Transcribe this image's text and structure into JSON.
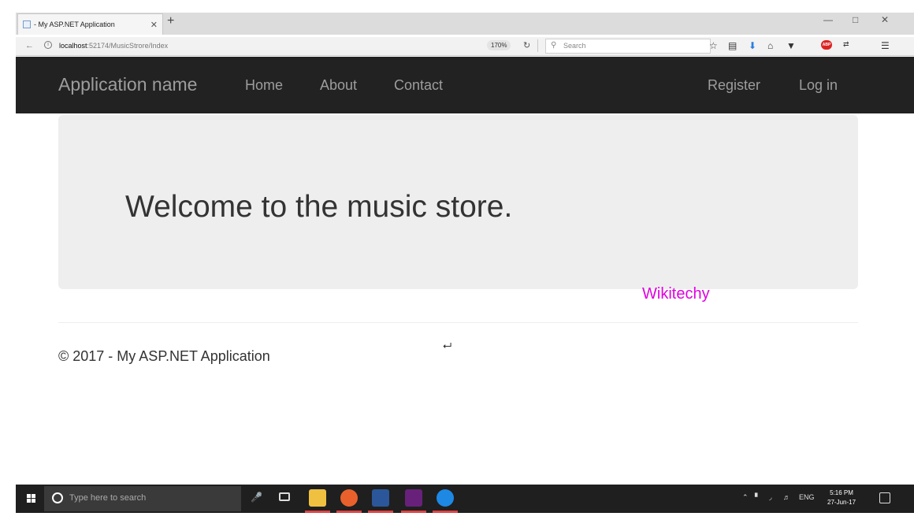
{
  "browser": {
    "tab_title": "- My ASP.NET Application",
    "tab_close": "✕",
    "new_tab": "+",
    "url_host": "localhost",
    "url_path": ":52174/MusicStrore/Index",
    "zoom": "170%",
    "search_placeholder": "Search"
  },
  "navbar": {
    "brand": "Application name",
    "links": [
      "Home",
      "About",
      "Contact"
    ],
    "register": "Register",
    "login": "Log in"
  },
  "jumbotron": {
    "title": "Welcome to the music store."
  },
  "watermark": "Wikitechy",
  "footer": {
    "text": "© 2017 - My ASP.NET Application"
  },
  "taskbar": {
    "search_placeholder": "Type here to search",
    "tray_lang": "ENG",
    "time": "5:16 PM",
    "date": "27-Jun-17"
  },
  "colors": {
    "navbar_bg": "#222222",
    "nav_text": "#9d9d9d",
    "jumbotron_bg": "#eeeeee",
    "watermark": "#e000e0"
  }
}
